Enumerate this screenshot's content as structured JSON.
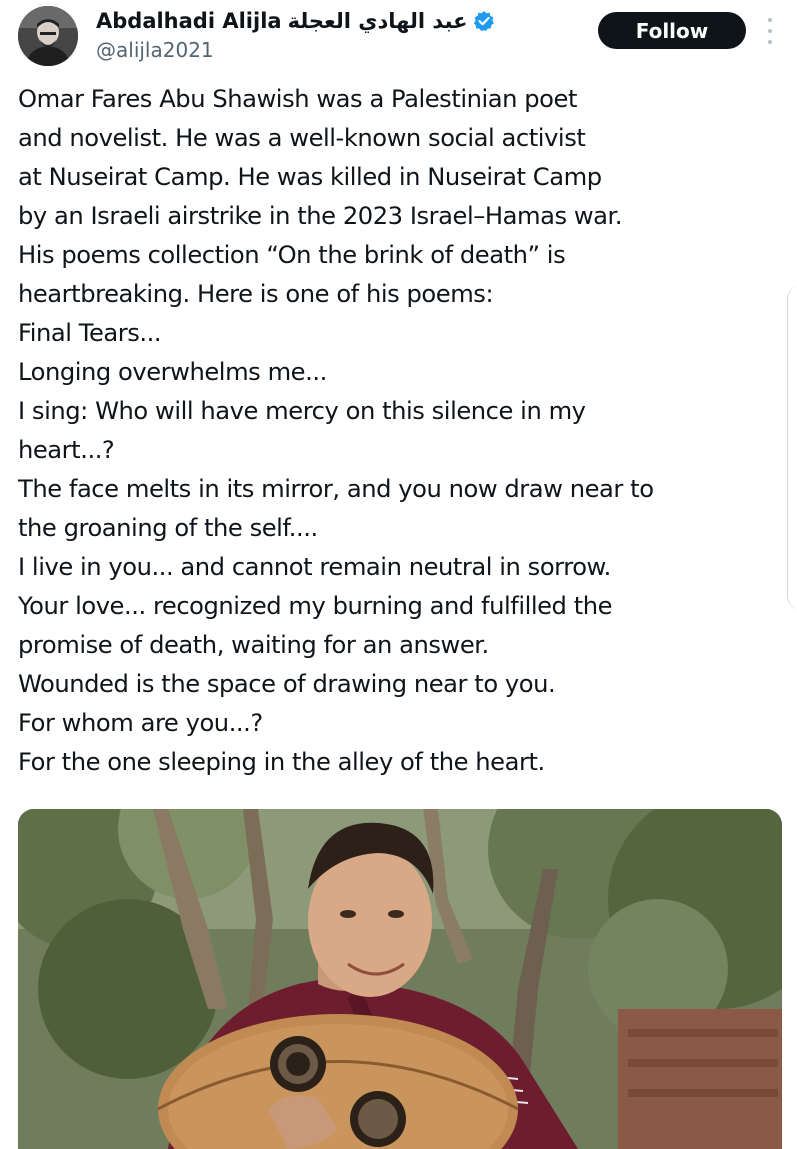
{
  "author": {
    "display_name": "Abdalhadi Alijla",
    "display_name_arabic": "عبد الهادي العجلة",
    "handle": "@alijla2021",
    "verified": true
  },
  "follow_button": {
    "label": "Follow"
  },
  "more_icon": "more-vertical-icon",
  "tweet": {
    "lines": [
      "Omar Fares Abu Shawish was a Palestinian poet",
      "and novelist. He was a well-known social activist",
      "at Nuseirat Camp. He was killed in Nuseirat Camp",
      "by an Israeli airstrike in the 2023 Israel–Hamas war.",
      "His poems collection “On the brink of death” is",
      "heartbreaking. Here is one of his poems:",
      "Final Tears...",
      "Longing overwhelms me...",
      "I sing: Who will have mercy on this silence in my",
      "heart...?",
      "The face melts in its mirror, and you now draw near to",
      "the groaning of the self....",
      "I live in you... and cannot remain neutral in sorrow.",
      "Your love... recognized my burning and fulfilled the",
      "promise of death, waiting for an answer.",
      "Wounded is the space of drawing near to you.",
      "For whom are you...?",
      "For the one sleeping in the alley of the heart."
    ]
  },
  "colors": {
    "text": "#0f1419",
    "secondary_text": "#536471",
    "follow_button_bg": "#0f1419",
    "follow_button_text": "#ffffff",
    "verified_badge": "#1d9bf0"
  }
}
